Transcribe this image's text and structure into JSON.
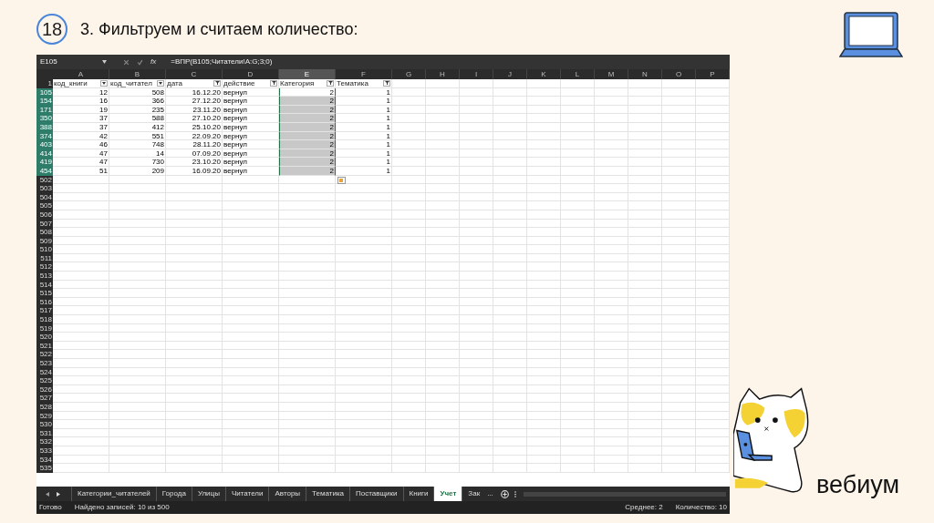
{
  "slide": {
    "number": "18",
    "title": "3. Фильтруем и считаем количество:",
    "logo": "вебиум"
  },
  "formula_bar": {
    "name_box": "E105",
    "fx": "fx",
    "formula": "=ВПР(B105;Читатели!A:G;3;0)"
  },
  "columns": [
    {
      "label": "A",
      "selected": false
    },
    {
      "label": "B",
      "selected": false
    },
    {
      "label": "C",
      "selected": false
    },
    {
      "label": "D",
      "selected": false
    },
    {
      "label": "E",
      "selected": true
    },
    {
      "label": "F",
      "selected": false
    },
    {
      "label": "G",
      "selected": false
    },
    {
      "label": "H",
      "selected": false
    },
    {
      "label": "I",
      "selected": false
    },
    {
      "label": "J",
      "selected": false
    },
    {
      "label": "K",
      "selected": false
    },
    {
      "label": "L",
      "selected": false
    },
    {
      "label": "M",
      "selected": false
    },
    {
      "label": "N",
      "selected": false
    },
    {
      "label": "O",
      "selected": false
    },
    {
      "label": "P",
      "selected": false
    }
  ],
  "header_row": {
    "number": "1",
    "cells": [
      {
        "text": "код_книги",
        "filtered": false
      },
      {
        "text": "код_читател",
        "filtered": false
      },
      {
        "text": "дата",
        "filtered": true
      },
      {
        "text": "действие",
        "filtered": true
      },
      {
        "text": "Категория",
        "filtered": true
      },
      {
        "text": "Тематика",
        "filtered": true
      }
    ]
  },
  "rows": [
    {
      "number": "105",
      "selected": true,
      "active": true,
      "cells": [
        "12",
        "508",
        "16.12.20",
        "вернул",
        "2",
        "1"
      ]
    },
    {
      "number": "154",
      "selected": true,
      "active": false,
      "cells": [
        "16",
        "366",
        "27.12.20",
        "вернул",
        "2",
        "1"
      ]
    },
    {
      "number": "171",
      "selected": true,
      "active": false,
      "cells": [
        "19",
        "235",
        "23.11.20",
        "вернул",
        "2",
        "1"
      ]
    },
    {
      "number": "350",
      "selected": true,
      "active": false,
      "cells": [
        "37",
        "588",
        "27.10.20",
        "вернул",
        "2",
        "1"
      ]
    },
    {
      "number": "388",
      "selected": true,
      "active": false,
      "cells": [
        "37",
        "412",
        "25.10.20",
        "вернул",
        "2",
        "1"
      ]
    },
    {
      "number": "374",
      "selected": true,
      "active": false,
      "cells": [
        "42",
        "551",
        "22.09.20",
        "вернул",
        "2",
        "1"
      ]
    },
    {
      "number": "403",
      "selected": true,
      "active": false,
      "cells": [
        "46",
        "748",
        "28.11.20",
        "вернул",
        "2",
        "1"
      ]
    },
    {
      "number": "414",
      "selected": true,
      "active": false,
      "cells": [
        "47",
        "14",
        "07.09.20",
        "вернул",
        "2",
        "1"
      ]
    },
    {
      "number": "419",
      "selected": true,
      "active": false,
      "cells": [
        "47",
        "730",
        "23.10.20",
        "вернул",
        "2",
        "1"
      ]
    },
    {
      "number": "454",
      "selected": true,
      "active": false,
      "cells": [
        "51",
        "209",
        "16.09.20",
        "вернул",
        "2",
        "1"
      ]
    }
  ],
  "empty_rows": [
    "502",
    "503",
    "504",
    "505",
    "506",
    "507",
    "508",
    "509",
    "510",
    "511",
    "512",
    "513",
    "514",
    "515",
    "516",
    "517",
    "518",
    "519",
    "520",
    "521",
    "522",
    "523",
    "524",
    "525",
    "526",
    "527",
    "528",
    "529",
    "530",
    "531",
    "532",
    "533",
    "534",
    "535"
  ],
  "sheet_tabs": [
    {
      "label": "Категории_читателей",
      "selected": false
    },
    {
      "label": "Города",
      "selected": false
    },
    {
      "label": "Улицы",
      "selected": false
    },
    {
      "label": "Читатели",
      "selected": false
    },
    {
      "label": "Авторы",
      "selected": false
    },
    {
      "label": "Тематика",
      "selected": false
    },
    {
      "label": "Поставщики",
      "selected": false
    },
    {
      "label": "Книги",
      "selected": false
    },
    {
      "label": "Учет",
      "selected": true
    },
    {
      "label": "Зак",
      "selected": false
    }
  ],
  "sheet_tabs_more": "...",
  "status_bar": {
    "mode": "Готово",
    "filter_info": "Найдено записей: 10 из 500",
    "average": "Среднее: 2",
    "count": "Количество: 10"
  }
}
